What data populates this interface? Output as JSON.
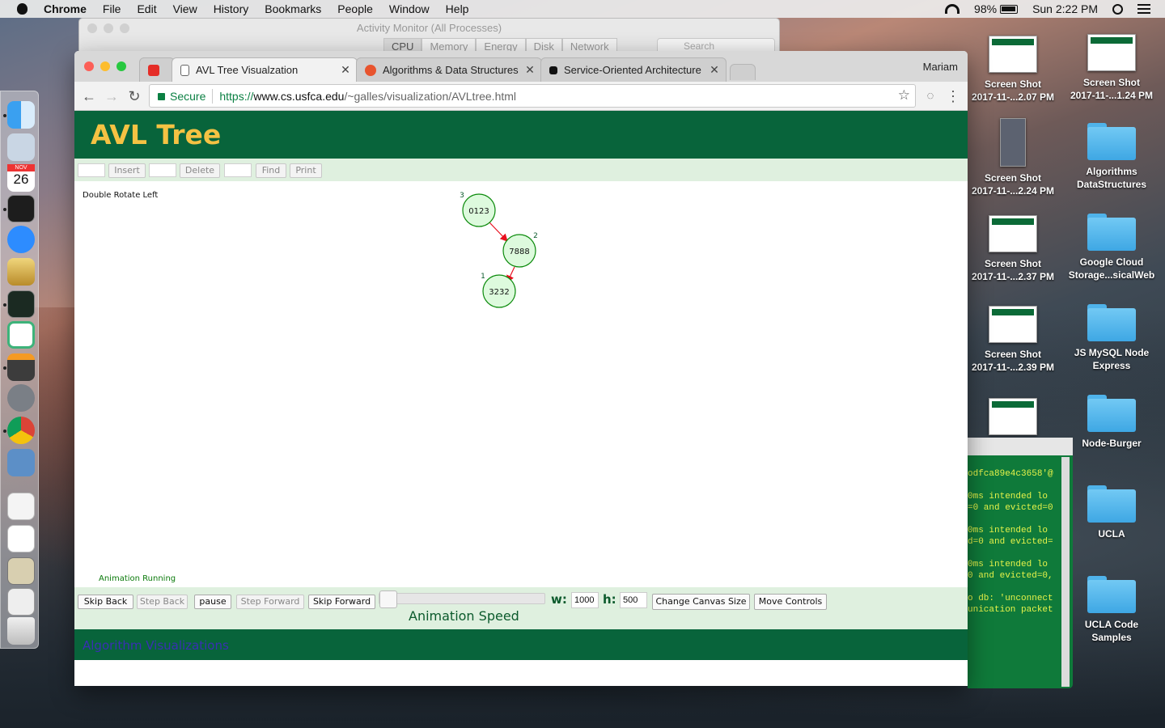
{
  "menubar": {
    "app": "Chrome",
    "items": [
      "File",
      "Edit",
      "View",
      "History",
      "Bookmarks",
      "People",
      "Window",
      "Help"
    ],
    "battery": "98%",
    "clock": "Sun 2:22 PM"
  },
  "dock": {
    "calendar_month": "NOV",
    "calendar_day": "26"
  },
  "activity_monitor": {
    "title": "Activity Monitor (All Processes)",
    "tabs": [
      "CPU",
      "Memory",
      "Energy",
      "Disk",
      "Network"
    ],
    "search_placeholder": "Search"
  },
  "desktop": {
    "col1": [
      {
        "line1": "Screen Shot",
        "line2": "2017-11-...2.07 PM",
        "kind": "thumb"
      },
      {
        "line1": "Screen Shot",
        "line2": "2017-11-...2.24 PM",
        "kind": "thumb-tall"
      },
      {
        "line1": "Screen Shot",
        "line2": "2017-11-...2.37 PM",
        "kind": "thumb"
      },
      {
        "line1": "Screen Shot",
        "line2": "2017-11-...2.39 PM",
        "kind": "thumb"
      },
      {
        "line1": "",
        "line2": "",
        "kind": "thumb"
      }
    ],
    "col2": [
      {
        "line1": "Screen Shot",
        "line2": "2017-11-...1.24 PM",
        "kind": "thumb"
      },
      {
        "line1": "Algorithms",
        "line2": "DataStructures",
        "kind": "folder"
      },
      {
        "line1": "Google Cloud",
        "line2": "Storage...sicalWeb",
        "kind": "folder"
      },
      {
        "line1": "JS MySQL Node",
        "line2": "Express",
        "kind": "folder"
      },
      {
        "line1": "Node-Burger",
        "line2": "",
        "kind": "folder"
      },
      {
        "line1": "UCLA",
        "line2": "",
        "kind": "folder"
      },
      {
        "line1": "UCLA Code",
        "line2": "Samples",
        "kind": "folder"
      }
    ]
  },
  "terminal": {
    "lines": [
      "odfca89e4c3658'@",
      "",
      "0ms intended lo",
      "=0 and evicted=0",
      "",
      "0ms intended lo",
      "d=0 and evicted=",
      "",
      "0ms intended lo",
      "0 and evicted=0,",
      "",
      "o db: 'unconnect",
      "unication packet"
    ]
  },
  "chrome": {
    "profile": "Mariam",
    "tabs": [
      {
        "label": "",
        "favicon": "#e52d27"
      },
      {
        "label": "AVL Tree Visualzation",
        "favicon": "#ffffff"
      },
      {
        "label": "Algorithms & Data Structures",
        "favicon": "#e8542e"
      },
      {
        "label": "Service-Oriented Architecture",
        "favicon": "#111111"
      }
    ],
    "omnibox": {
      "secure": "Secure",
      "scheme": "https://",
      "host": "www.cs.usfca.edu",
      "path": "/~galles/visualization/AVLtree.html"
    }
  },
  "page": {
    "title": "AVL Tree",
    "controls": {
      "insert": "Insert",
      "delete": "Delete",
      "find": "Find",
      "print": "Print"
    },
    "status": "Double Rotate Left",
    "running": "Animation Running",
    "tree": {
      "nodes": [
        {
          "key": "0123",
          "height": "3"
        },
        {
          "key": "7888",
          "height": "2"
        },
        {
          "key": "3232",
          "height": "1"
        }
      ],
      "edge_color": "#e8101f",
      "node_fill": "#ddfadd",
      "node_stroke": "#0b8a0b"
    },
    "anim": {
      "skip_back": "Skip Back",
      "step_back": "Step Back",
      "pause": "pause",
      "step_forward": "Step Forward",
      "skip_forward": "Skip Forward",
      "speed_label": "Animation Speed",
      "w_label": "w:",
      "w_value": "1000",
      "h_label": "h:",
      "h_value": "500",
      "change_canvas": "Change Canvas Size",
      "move_controls": "Move Controls"
    },
    "footer_link": "Algorithm Visualizations",
    "colors": {
      "banner": "#08643b",
      "title": "#f5c243",
      "control_band": "#dff0df"
    }
  }
}
